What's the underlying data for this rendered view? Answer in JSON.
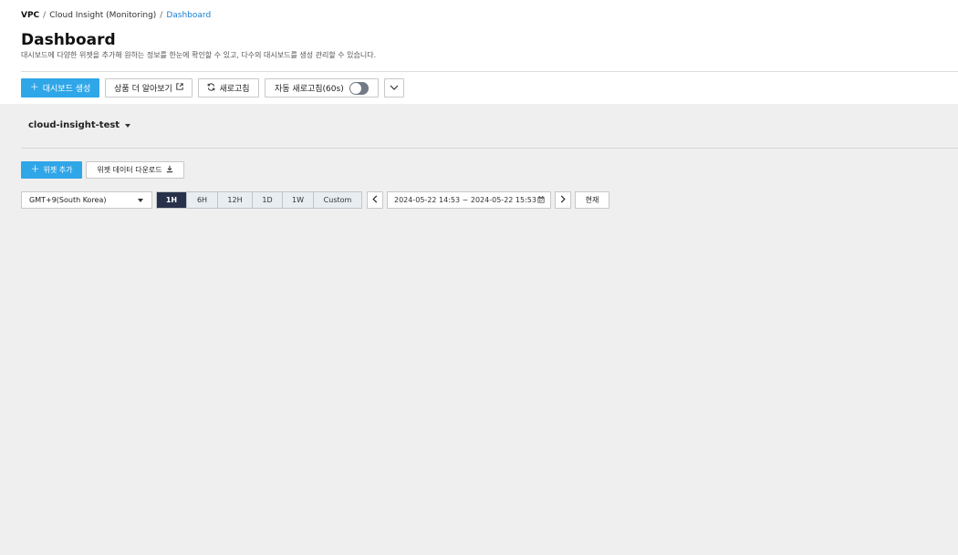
{
  "breadcrumb": {
    "root": "VPC",
    "middle": "Cloud Insight (Monitoring)",
    "current": "Dashboard",
    "separator": "/"
  },
  "page": {
    "title": "Dashboard",
    "description": "대시보드에 다양한 위젯을 추가해 원하는 정보를 한눈에 확인할 수 있고, 다수의 대시보드를 생성 관리할 수 있습니다."
  },
  "toolbar": {
    "create_label": "대시보드 생성",
    "create_icon": "plus-icon",
    "learn_label": "상품 더 알아보기",
    "learn_icon": "external-link-icon",
    "refresh_label": "새로고침",
    "refresh_icon": "refresh-icon",
    "auto_refresh_label": "자동 새로고침(60s)",
    "auto_refresh_on": false,
    "more_icon": "chevron-down-icon"
  },
  "dashboard_selector": {
    "value": "cloud-insight-test",
    "icon": "caret-down-icon"
  },
  "widget_bar": {
    "add_label": "위젯 추가",
    "add_icon": "plus-icon",
    "download_label": "위젯 데이터 다운로드",
    "download_icon": "download-icon"
  },
  "time_controls": {
    "timezone": "GMT+9(South Korea)",
    "ranges": [
      "1H",
      "6H",
      "12H",
      "1D",
      "1W",
      "Custom"
    ],
    "active_range": "1H",
    "date_range": "2024-05-22 14:53 ~ 2024-05-22 15:53",
    "calendar_icon": "calendar-icon",
    "prev_icon": "chevron-left-icon",
    "next_icon": "chevron-right-icon",
    "now_label": "현재"
  },
  "colors": {
    "primary": "#2fa6e8",
    "active_range": "#27314a",
    "link": "#1a7fd4",
    "content_bg": "#efefef"
  }
}
